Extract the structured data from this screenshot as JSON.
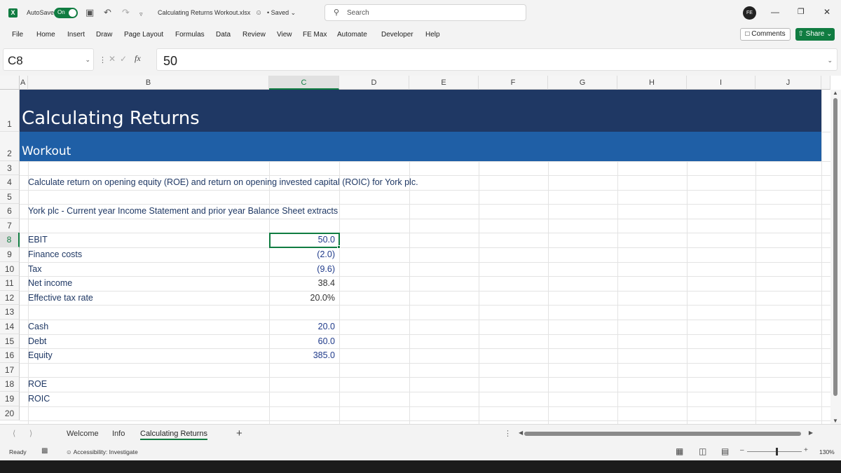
{
  "window": {
    "autosave_label": "AutoSave",
    "autosave_state": "On",
    "doc_title": "Calculating Returns Workout.xlsx",
    "saved_status": "• Saved",
    "search_placeholder": "Search",
    "avatar_initials": "FE"
  },
  "menu": {
    "items": [
      "File",
      "Home",
      "Insert",
      "Draw",
      "Page Layout",
      "Formulas",
      "Data",
      "Review",
      "View",
      "FE Max",
      "Automate",
      "Developer",
      "Help"
    ],
    "comments_label": "Comments",
    "share_label": "Share"
  },
  "formula_bar": {
    "name_box": "C8",
    "fx_label": "fx",
    "content": "50"
  },
  "columns": [
    "A",
    "B",
    "C",
    "D",
    "E",
    "F",
    "G",
    "H",
    "I",
    "J"
  ],
  "selected_column": "C",
  "rows": [
    "1",
    "2",
    "3",
    "4",
    "5",
    "6",
    "7",
    "8",
    "9",
    "10",
    "11",
    "12",
    "13",
    "14",
    "15",
    "16",
    "17",
    "18",
    "19",
    "20"
  ],
  "selected_row": "8",
  "sheet": {
    "title": "Calculating Returns",
    "subtitle": "Workout",
    "instruction": "Calculate return on opening equity (ROE) and return on opening invested capital (ROIC) for York plc.",
    "extract_heading": "York plc - Current year Income Statement and prior year Balance Sheet extracts",
    "items": [
      {
        "row": "8",
        "label": "EBIT",
        "value": "50.0",
        "value_color": "#1f3a8a"
      },
      {
        "row": "9",
        "label": "Finance costs",
        "value": "(2.0)",
        "value_color": "#1f3a8a"
      },
      {
        "row": "10",
        "label": "Tax",
        "value": "(9.6)",
        "value_color": "#1f3a8a"
      },
      {
        "row": "11",
        "label": "Net income",
        "value": "38.4",
        "value_color": "#333333"
      },
      {
        "row": "12",
        "label": "Effective tax rate",
        "value": "20.0%",
        "value_color": "#333333"
      },
      {
        "row": "14",
        "label": "Cash",
        "value": "20.0",
        "value_color": "#1f3a8a"
      },
      {
        "row": "15",
        "label": "Debt",
        "value": "60.0",
        "value_color": "#1f3a8a"
      },
      {
        "row": "16",
        "label": "Equity",
        "value": "385.0",
        "value_color": "#1f3a8a"
      },
      {
        "row": "18",
        "label": "ROE",
        "value": "",
        "value_color": "#333333"
      },
      {
        "row": "19",
        "label": "ROIC",
        "value": "",
        "value_color": "#333333"
      }
    ]
  },
  "tabs": {
    "items": [
      "Welcome",
      "Info",
      "Calculating Returns"
    ],
    "active": "Calculating Returns"
  },
  "status": {
    "ready": "Ready",
    "accessibility": "Accessibility: Investigate",
    "zoom": "130%"
  },
  "colors": {
    "excel_green": "#107c41",
    "title_band": "#1f3864",
    "subtitle_band": "#1f5fa6"
  }
}
